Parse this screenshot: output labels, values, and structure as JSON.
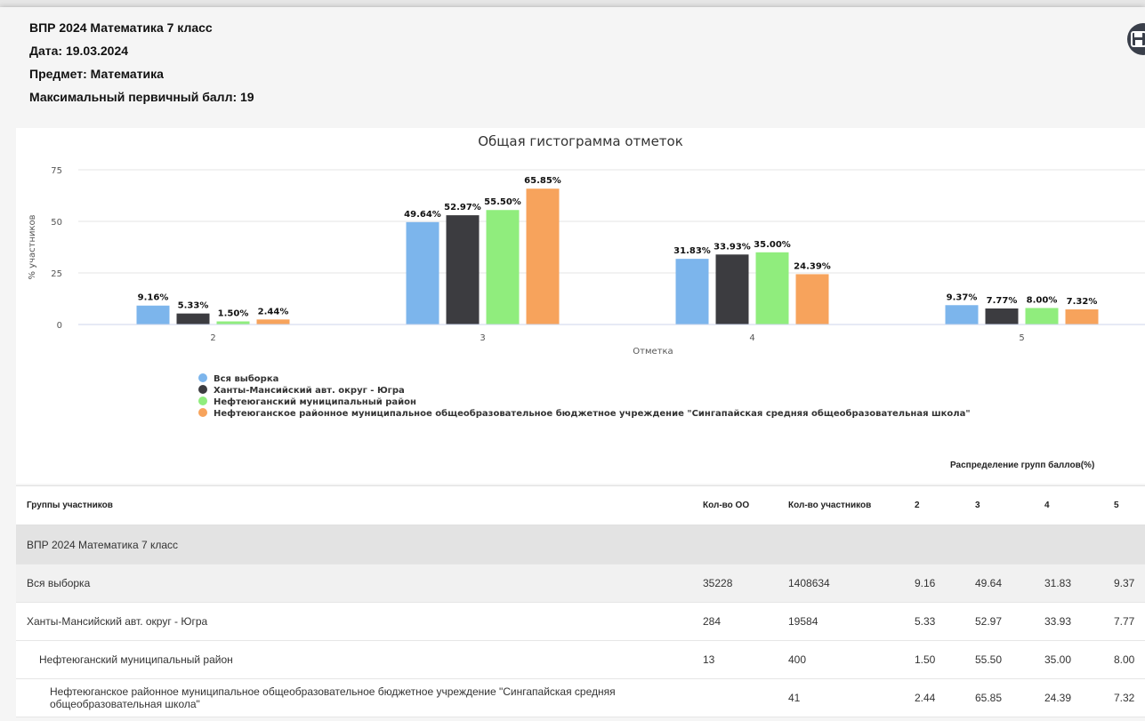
{
  "header": {
    "title": "ВПР 2024 Математика 7 класс",
    "date": "Дата: 19.03.2024",
    "subject": "Предмет: Математика",
    "max_score": "Максимальный первичный балл: 19"
  },
  "icons": {
    "save": "floppy-disk-icon"
  },
  "chart_data": {
    "type": "bar",
    "title": "Общая гистограмма отметок",
    "xlabel": "Отметка",
    "ylabel": "% участников",
    "ylim": [
      0,
      75
    ],
    "yticks": [
      "0",
      "25",
      "50",
      "75"
    ],
    "categories": [
      "2",
      "3",
      "4",
      "5"
    ],
    "legend_position": "bottom-left",
    "grid": true,
    "series": [
      {
        "name": "Вся выборка",
        "color": "#7cb5ec",
        "values": [
          9.16,
          49.64,
          31.83,
          9.37
        ],
        "labels": [
          "9.16%",
          "49.64%",
          "31.83%",
          "9.37%"
        ]
      },
      {
        "name": "Ханты-Мансийский авт. округ - Югра",
        "color": "#3c3c40",
        "values": [
          5.33,
          52.97,
          33.93,
          7.77
        ],
        "labels": [
          "5.33%",
          "52.97%",
          "33.93%",
          "7.77%"
        ]
      },
      {
        "name": "Нефтеюганский муниципальный район",
        "color": "#90ed7d",
        "values": [
          1.5,
          55.5,
          35.0,
          8.0
        ],
        "labels": [
          "1.50%",
          "55.50%",
          "35.00%",
          "8.00%"
        ]
      },
      {
        "name": "Нефтеюганское районное муниципальное общеобразовательное бюджетное учреждение \"Сингапайская средняя общеобразовательная школа\"",
        "color": "#f7a35c",
        "values": [
          2.44,
          65.85,
          24.39,
          7.32
        ],
        "labels": [
          "2.44%",
          "65.85%",
          "24.39%",
          "7.32%"
        ]
      }
    ]
  },
  "table": {
    "distribution_label": "Распределение групп баллов(%)",
    "headers": [
      "Группы участников",
      "Кол-во ОО",
      "Кол-во участников",
      "2",
      "3",
      "4",
      "5"
    ],
    "group_title": "ВПР 2024 Математика 7 класс",
    "rows": [
      {
        "name": "Вся выборка",
        "oo": "35228",
        "participants": "1408634",
        "g2": "9.16",
        "g3": "49.64",
        "g4": "31.83",
        "g5": "9.37"
      },
      {
        "name": "Ханты-Мансийский авт. округ - Югра",
        "oo": "284",
        "participants": "19584",
        "g2": "5.33",
        "g3": "52.97",
        "g4": "33.93",
        "g5": "7.77"
      },
      {
        "name": "Нефтеюганский муниципальный район",
        "oo": "13",
        "participants": "400",
        "g2": "1.50",
        "g3": "55.50",
        "g4": "35.00",
        "g5": "8.00"
      },
      {
        "name": "Нефтеюганское районное муниципальное общеобразовательное бюджетное учреждение \"Сингапайская средняя общеобразовательная школа\"",
        "oo": "",
        "participants": "41",
        "g2": "2.44",
        "g3": "65.85",
        "g4": "24.39",
        "g5": "7.32"
      }
    ]
  }
}
